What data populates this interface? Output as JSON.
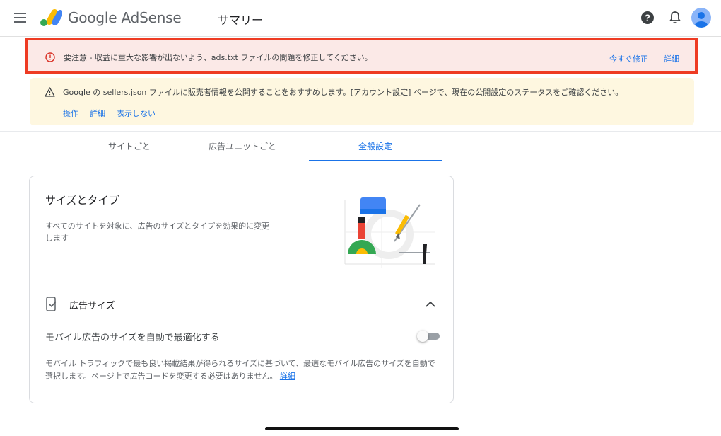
{
  "header": {
    "brand": "Google AdSense",
    "page_title": "サマリー"
  },
  "alert_error": {
    "message": "要注意 - 収益に重大な影響が出ないよう、ads.txt ファイルの問題を修正してください。",
    "fix_label": "今すぐ修正",
    "detail_label": "詳細"
  },
  "alert_warning": {
    "message": "Google の sellers.json ファイルに販売者情報を公開することをおすすめします。[アカウント設定] ページで、現在の公開設定のステータスをご確認ください。",
    "actions": [
      "操作",
      "詳細",
      "表示しない"
    ]
  },
  "tabs": [
    {
      "label": "サイトごと",
      "active": false
    },
    {
      "label": "広告ユニットごと",
      "active": false
    },
    {
      "label": "全般設定",
      "active": true
    }
  ],
  "card": {
    "title": "サイズとタイプ",
    "description": "すべてのサイトを対象に、広告のサイズとタイプを効果的に変更します",
    "section_title": "広告サイズ",
    "option_label": "モバイル広告のサイズを自動で最適化する",
    "option_enabled": false,
    "option_description": "モバイル トラフィックで最も良い掲載結果が得られるサイズに基づいて、最適なモバイル広告のサイズを自動で選択します。ページ上で広告コードを変更する必要はありません。",
    "option_link": "詳細"
  },
  "colors": {
    "accent": "#1a73e8",
    "error_border": "#ee3b23",
    "error_bg": "#fbe9e7",
    "warning_bg": "#fef7e0"
  },
  "icons": [
    "menu-icon",
    "adsense-logo-icon",
    "help-icon",
    "bell-icon",
    "avatar-icon",
    "error-icon",
    "warning-icon",
    "mobile-check-icon",
    "chevron-up-icon"
  ]
}
